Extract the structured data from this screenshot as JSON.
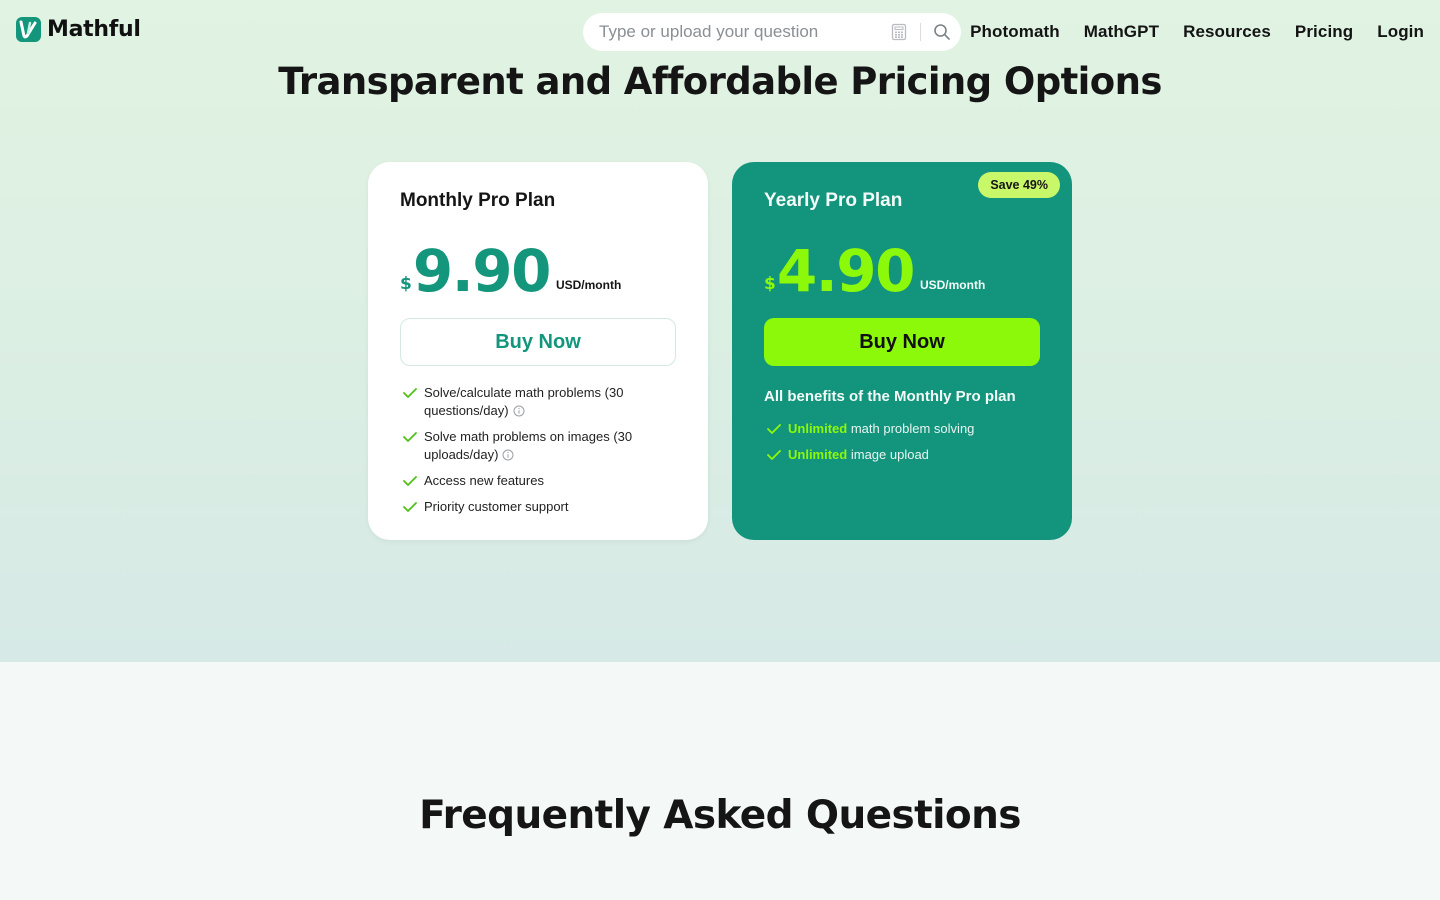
{
  "header": {
    "logo_text": "Mathful",
    "search_placeholder": "Type or upload your question",
    "nav": [
      "Photomath",
      "MathGPT",
      "Resources",
      "Pricing",
      "Login"
    ]
  },
  "hero": {
    "title": "Transparent and Affordable Pricing Options"
  },
  "plans": {
    "monthly": {
      "name": "Monthly Pro Plan",
      "currency": "$",
      "price": "9.90",
      "unit": "USD/month",
      "button": "Buy Now",
      "features": [
        "Solve/calculate math problems (30 questions/day)",
        "Solve math problems on images (30 uploads/day)",
        "Access new features",
        "Priority customer support"
      ]
    },
    "yearly": {
      "name": "Yearly Pro Plan",
      "badge": "Save 49%",
      "currency": "$",
      "price": "4.90",
      "unit": "USD/month",
      "button": "Buy Now",
      "benefits_title": "All benefits of the Monthly Pro plan",
      "features": [
        {
          "highlight": "Unlimited",
          "text": " math problem solving"
        },
        {
          "highlight": "Unlimited",
          "text": " image upload"
        }
      ]
    }
  },
  "faq": {
    "title": "Frequently Asked Questions"
  },
  "colors": {
    "brand_teal": "#14967c",
    "accent_lime": "#8cf90a",
    "badge_lime": "#c8f76a"
  },
  "icons": [
    "logo-icon",
    "calculator-icon",
    "search-icon",
    "check-icon",
    "info-icon"
  ]
}
